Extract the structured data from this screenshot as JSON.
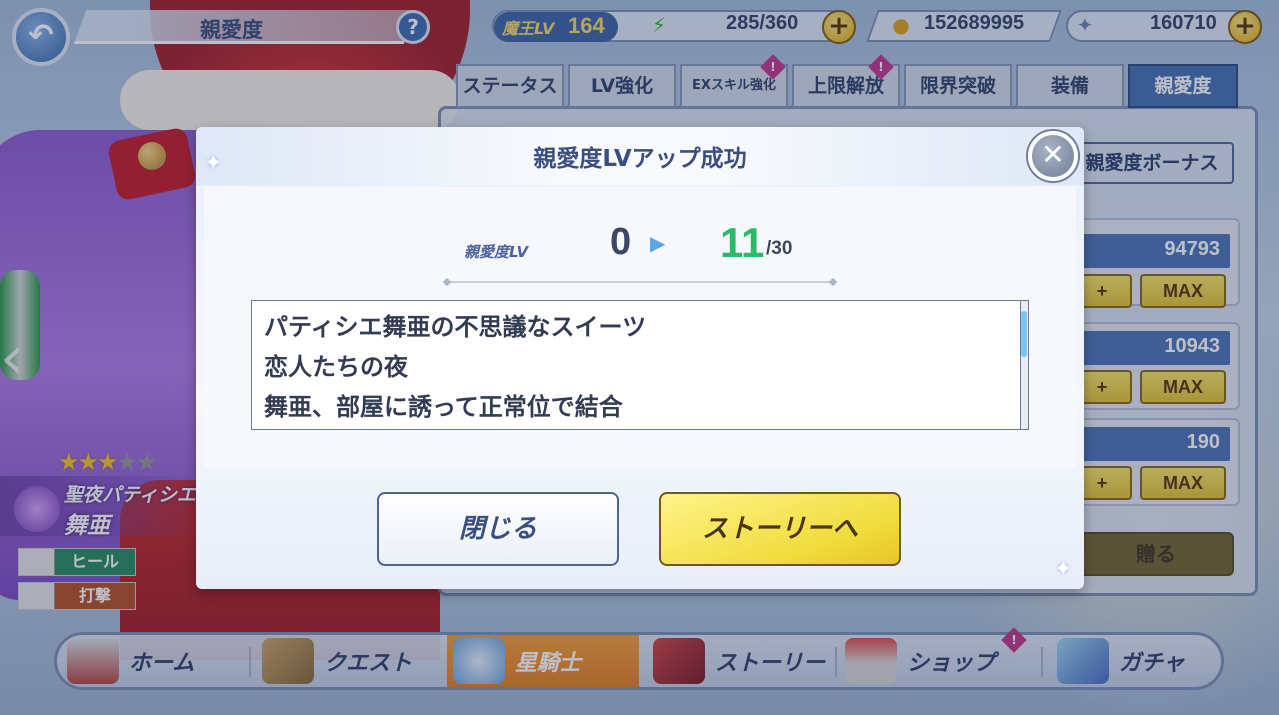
{
  "header": {
    "page_title": "親愛度",
    "help_label": "?",
    "back_label": "↶",
    "player_level_label": "魔王LV",
    "player_level": "164",
    "stamina": "285/360",
    "coins": "152689995",
    "gems": "160710"
  },
  "tabs": [
    {
      "label": "ステータス",
      "active": false
    },
    {
      "label": "LV強化",
      "active": false
    },
    {
      "label": "EXスキル強化",
      "active": false,
      "alert": true
    },
    {
      "label": "上限解放",
      "active": false,
      "alert": true
    },
    {
      "label": "限界突破",
      "active": false
    },
    {
      "label": "装備",
      "active": false
    },
    {
      "label": "親愛度",
      "active": true
    }
  ],
  "side_panel": {
    "bonus_button": "親愛度ボーナス",
    "values": [
      "94793",
      "10943",
      "190"
    ],
    "plus_label": "+",
    "max_label": "MAX",
    "gift_button": "贈る"
  },
  "character": {
    "stars_filled": 3,
    "stars_total": 5,
    "subtitle": "聖夜パティシエ",
    "name": "舞亜",
    "role": "ヒール",
    "attack_type": "打撃"
  },
  "modal": {
    "title": "親愛度LVアップ成功",
    "close_icon": "close-icon",
    "level_label": "親愛度LV",
    "level_from": "0",
    "level_to": "11",
    "level_max": "/30",
    "stories": [
      "パティシエ舞亜の不思議なスイーツ",
      "恋人たちの夜",
      "舞亜、部屋に誘って正常位で結合"
    ],
    "close_button": "閉じる",
    "story_button": "ストーリーへ"
  },
  "bottom_nav": [
    {
      "label": "ホーム",
      "active": false
    },
    {
      "label": "クエスト",
      "active": false
    },
    {
      "label": "星騎士",
      "active": true
    },
    {
      "label": "ストーリー",
      "active": false
    },
    {
      "label": "ショップ",
      "active": false,
      "alert": true
    },
    {
      "label": "ガチャ",
      "active": false
    }
  ],
  "colors": {
    "accent": "#4873b5",
    "level_up_green": "#2bba6a",
    "primary_button": "#f0dc3c"
  }
}
